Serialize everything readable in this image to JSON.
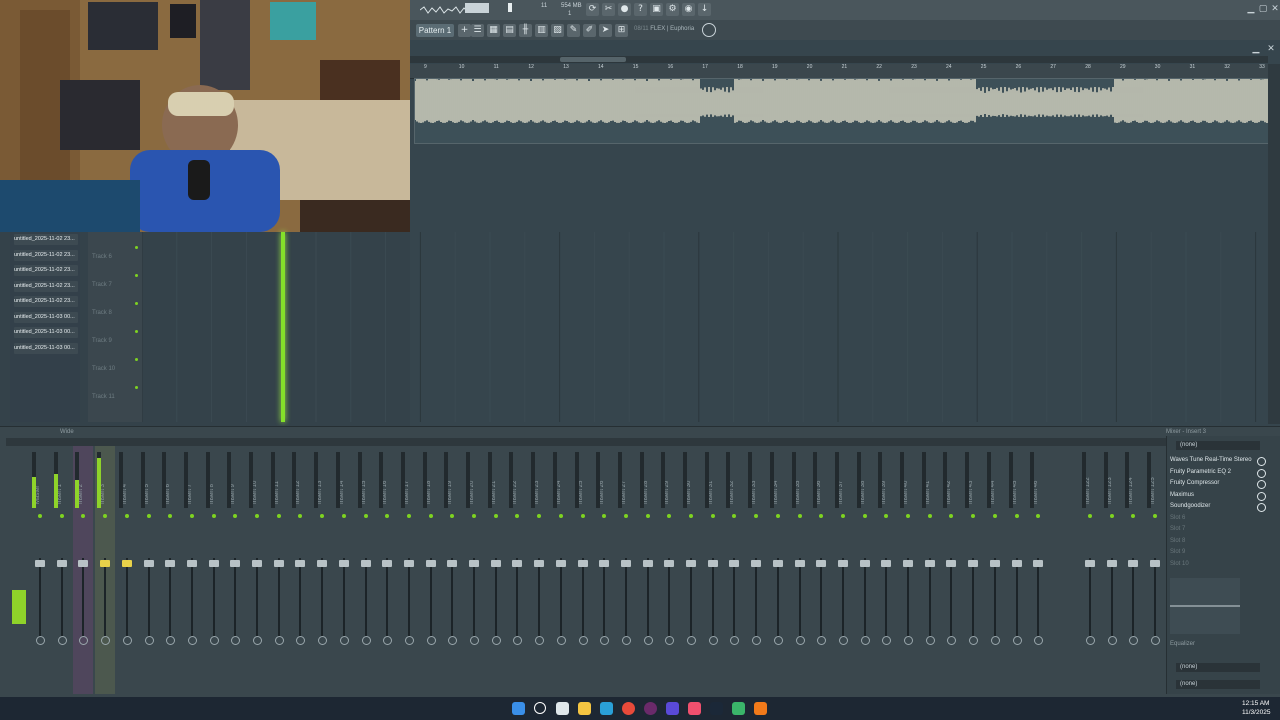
{
  "toolbar": {
    "memory": "554 MB",
    "cpu": "11",
    "voices": "1",
    "pattern_label": "Pattern 1",
    "plugin_slot": "08/11",
    "plugin_name": "FLEX | Euphoria"
  },
  "browser": {
    "items": [
      "untitled_2025-11-02 23...",
      "untitled_2025-11-02 23...",
      "untitled_2025-11-02 23...",
      "untitled_2025-11-02 23...",
      "untitled_2025-11-02 23...",
      "untitled_2025-11-03 00...",
      "untitled_2025-11-03 00...",
      "untitled_2025-11-03 00..."
    ]
  },
  "playlist": {
    "ruler_marks": [
      "9",
      "10",
      "11",
      "12",
      "13",
      "14",
      "15",
      "16",
      "17",
      "18",
      "19",
      "20",
      "21",
      "22",
      "23",
      "24",
      "25",
      "26",
      "27",
      "28",
      "29",
      "30",
      "31",
      "32",
      "33"
    ],
    "tracks": [
      "Track 6",
      "Track 7",
      "Track 8",
      "Track 9",
      "Track 10",
      "Track 11"
    ]
  },
  "mixer": {
    "title": "Wide",
    "right_title": "Mixer - Insert 3",
    "strips": [
      "Master",
      "Insert 1",
      "Insert 2",
      "Insert 3",
      "Insert 4",
      "Insert 5",
      "Insert 6",
      "Insert 7",
      "Insert 8",
      "Insert 9",
      "Insert 10",
      "Insert 11",
      "Insert 12",
      "Insert 13",
      "Insert 14",
      "Insert 15",
      "Insert 16",
      "Insert 17",
      "Insert 18",
      "Insert 19",
      "Insert 20",
      "Insert 21",
      "Insert 22",
      "Insert 23",
      "Insert 24",
      "Insert 25",
      "Insert 26",
      "Insert 27",
      "Insert 28",
      "Insert 29",
      "Insert 30",
      "Insert 31",
      "Insert 32",
      "Insert 33",
      "Insert 34",
      "Insert 35",
      "Insert 36",
      "Insert 37",
      "Insert 38",
      "Insert 39",
      "Insert 40",
      "Insert 41",
      "Insert 42",
      "Insert 43",
      "Insert 44",
      "Insert 45",
      "Insert 46"
    ],
    "extra_strips": [
      "Insert 122",
      "Insert 123",
      "Insert 124",
      "Insert 125"
    ],
    "input": "(none)",
    "fx_slots": [
      "Waves Tune Real-Time Stereo",
      "Fruity Parametric EQ 2",
      "Fruity Compressor",
      "Maximus",
      "Soundgoodizer",
      "Slot 6",
      "Slot 7",
      "Slot 8",
      "Slot 9",
      "Slot 10"
    ],
    "eq_label": "Equalizer",
    "output_1": "(none)",
    "output_2": "(none)"
  },
  "taskbar": {
    "time": "12:15 AM",
    "date": "11/3/2025"
  }
}
